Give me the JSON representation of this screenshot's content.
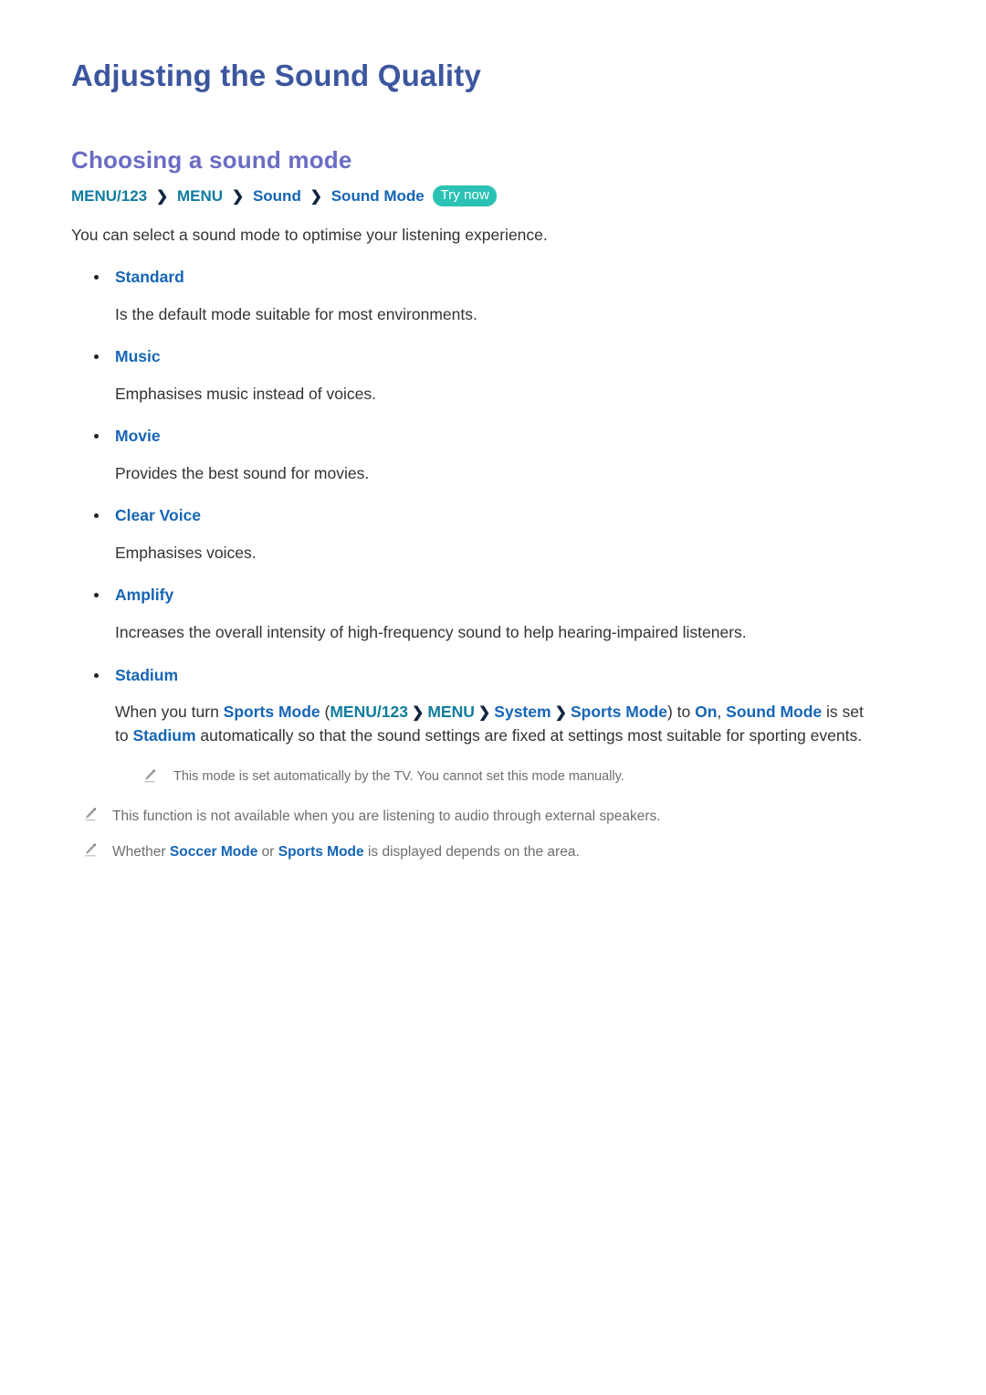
{
  "document": {
    "title": "Adjusting the Sound Quality",
    "section_heading": "Choosing a sound mode",
    "intro": "You can select a sound mode to optimise your listening experience."
  },
  "breadcrumb": {
    "items": [
      {
        "label": "MENU/123",
        "style": "teal"
      },
      {
        "label": "MENU",
        "style": "teal"
      },
      {
        "label": "Sound",
        "style": "blue"
      },
      {
        "label": "Sound Mode",
        "style": "blue"
      }
    ],
    "separator": "❯",
    "badge": "Try now"
  },
  "modes": [
    {
      "term": "Standard",
      "desc": "Is the default mode suitable for most environments."
    },
    {
      "term": "Music",
      "desc": "Emphasises music instead of voices."
    },
    {
      "term": "Movie",
      "desc": "Provides the best sound for movies."
    },
    {
      "term": "Clear Voice",
      "desc": "Emphasises voices."
    },
    {
      "term": "Amplify",
      "desc": "Increases the overall intensity of high-frequency sound to help hearing-impaired listeners."
    },
    {
      "term": "Stadium",
      "desc": ""
    }
  ],
  "stadium_paragraph": {
    "t1": "When you turn ",
    "b1": "Sports Mode",
    "t2": " (",
    "c1": "MENU/123",
    "sep1": "❯",
    "c2": "MENU",
    "sep2": "❯",
    "c3": "System",
    "sep3": "❯",
    "c4": "Sports Mode",
    "t3": ") to ",
    "b2": "On",
    "t4": ", ",
    "b3": "Sound Mode",
    "t5": " is set to ",
    "b4": "Stadium",
    "t6": " automatically so that the sound settings are fixed at settings most suitable for sporting events."
  },
  "notes": [
    {
      "icon": "pencil-icon",
      "indented": true,
      "text": "This mode is set automatically by the TV. You cannot set this mode manually."
    },
    {
      "icon": "pencil-icon",
      "indented": false,
      "text": "This function is not available when you are listening to audio through external speakers."
    },
    {
      "icon": "pencil-icon",
      "indented": false,
      "segments": {
        "t1": "Whether ",
        "b1": "Soccer Mode",
        "t2": " or ",
        "b2": "Sports Mode",
        "t3": " is displayed depends on the area."
      }
    }
  ],
  "colors": {
    "title": "#3c569e",
    "section_heading": "#6b6cc4",
    "breadcrumb_teal": "#0f7d9e",
    "breadcrumb_blue": "#1565b5",
    "badge_bg": "#2bc2b4",
    "body_text": "#333333",
    "note_text": "#6e6e6e"
  }
}
